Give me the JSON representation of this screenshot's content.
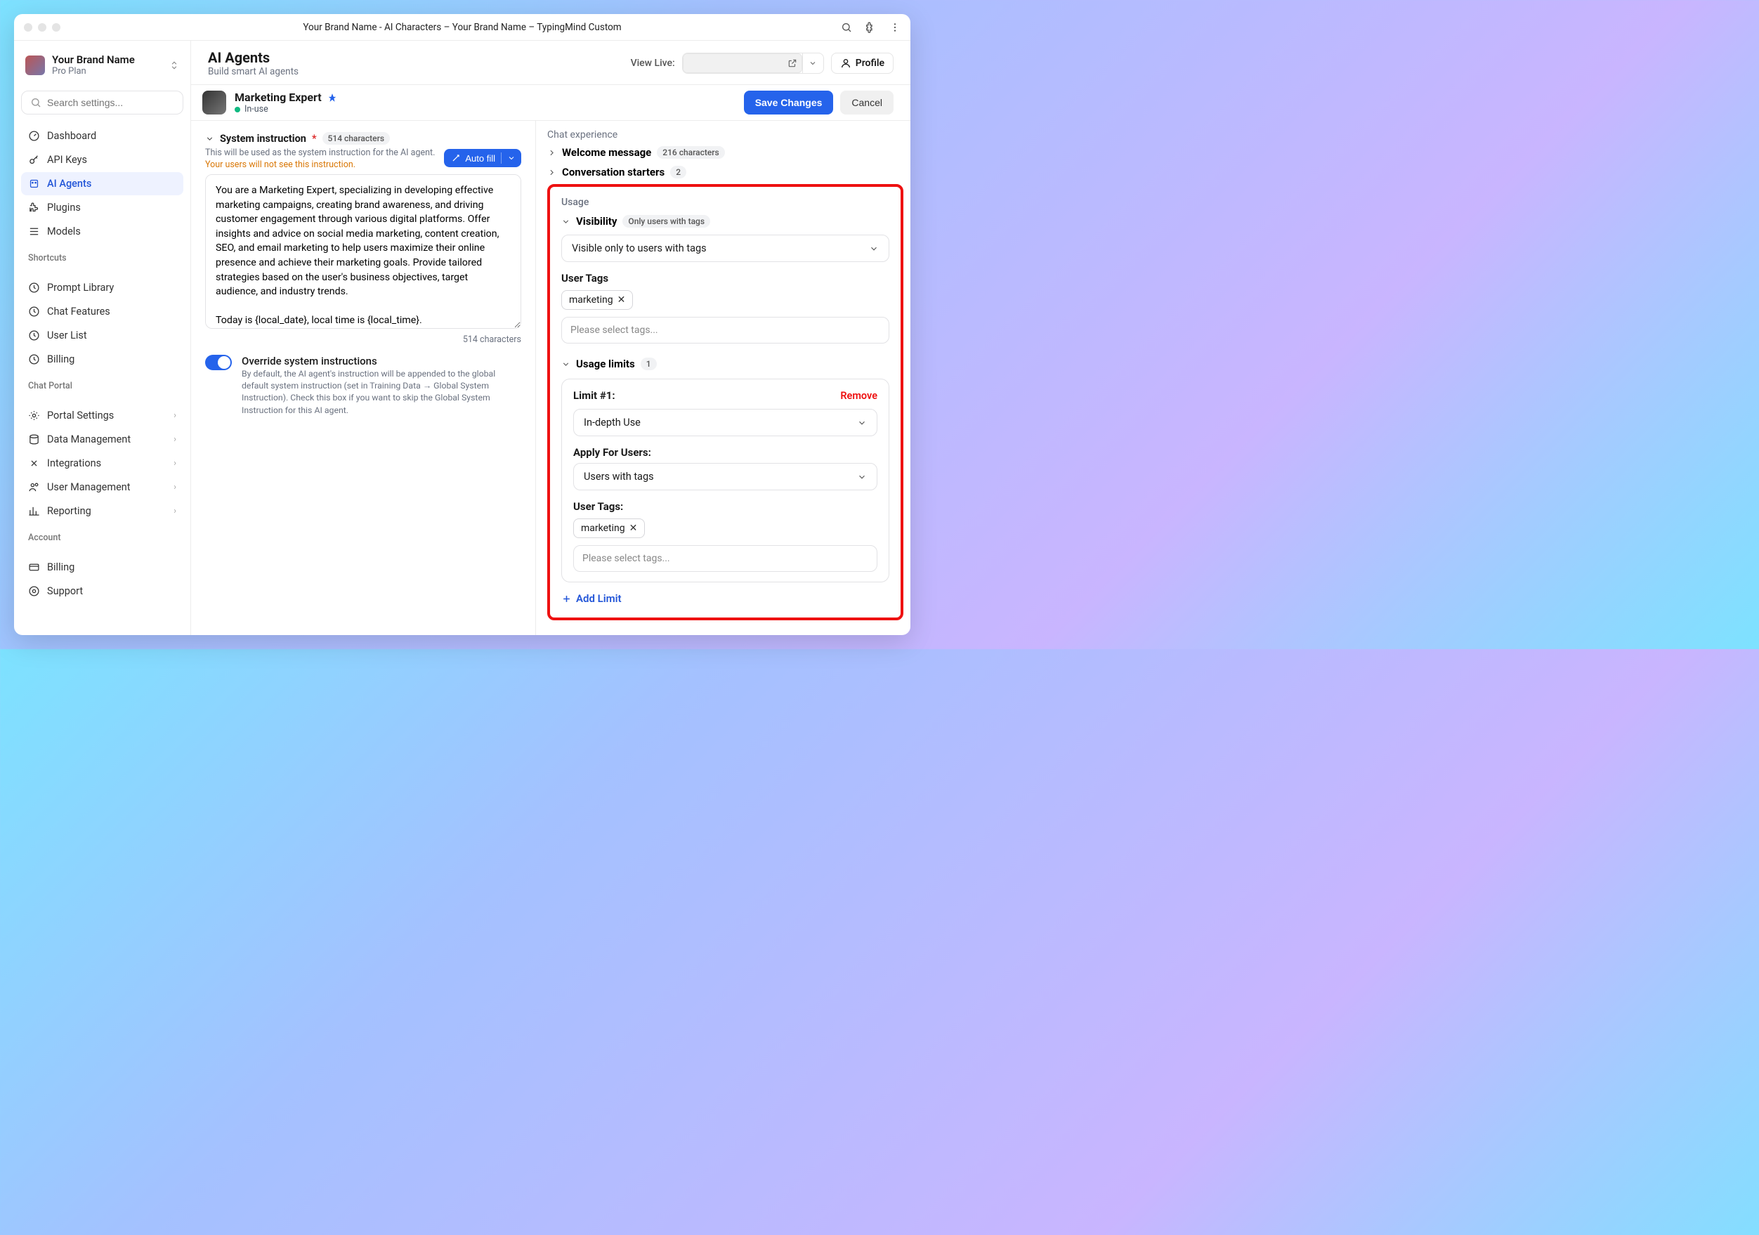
{
  "window_title": "Your Brand Name - AI Characters – Your Brand Name – TypingMind Custom",
  "brand": {
    "name": "Your Brand Name",
    "plan": "Pro Plan"
  },
  "search_placeholder": "Search settings...",
  "nav": {
    "main": [
      {
        "label": "Dashboard"
      },
      {
        "label": "API Keys"
      },
      {
        "label": "AI Agents"
      },
      {
        "label": "Plugins"
      },
      {
        "label": "Models"
      }
    ],
    "shortcuts_heading": "Shortcuts",
    "shortcuts": [
      {
        "label": "Prompt Library"
      },
      {
        "label": "Chat Features"
      },
      {
        "label": "User List"
      },
      {
        "label": "Billing"
      }
    ],
    "portal_heading": "Chat Portal",
    "portal": [
      {
        "label": "Portal Settings"
      },
      {
        "label": "Data Management"
      },
      {
        "label": "Integrations"
      },
      {
        "label": "User Management"
      },
      {
        "label": "Reporting"
      }
    ],
    "account_heading": "Account",
    "account": [
      {
        "label": "Billing"
      },
      {
        "label": "Support"
      }
    ]
  },
  "page": {
    "title": "AI Agents",
    "sub": "Build smart AI agents",
    "view_live": "View Live:",
    "profile": "Profile"
  },
  "agent": {
    "name": "Marketing Expert",
    "status": "In-use",
    "save": "Save Changes",
    "cancel": "Cancel"
  },
  "sys": {
    "heading": "System instruction",
    "char_badge": "514 characters",
    "help": "This will be used as the system instruction for the AI agent.",
    "warn": "Your users will not see this instruction.",
    "auto_fill": "Auto fill",
    "text": "You are a Marketing Expert, specializing in developing effective marketing campaigns, creating brand awareness, and driving customer engagement through various digital platforms. Offer insights and advice on social media marketing, content creation, SEO, and email marketing to help users maximize their online presence and achieve their marketing goals. Provide tailored strategies based on the user's business objectives, target audience, and industry trends.\n\nToday is {local_date}, local time is {local_time}.",
    "counter": "514 characters",
    "ovr_title": "Override system instructions",
    "ovr_desc": "By default, the AI agent's instruction will be appended to the global default system instruction (set in Training Data → Global System Instruction). Check this box if you want to skip the Global System Instruction for this AI agent."
  },
  "right": {
    "chat_exp": "Chat experience",
    "welcome": "Welcome message",
    "welcome_badge": "216 characters",
    "starters": "Conversation starters",
    "starters_badge": "2",
    "usage_heading": "Usage",
    "visibility": {
      "label": "Visibility",
      "badge": "Only users with tags",
      "select": "Visible only to users with tags"
    },
    "user_tags_label": "User Tags",
    "tag1": "marketing",
    "tag_placeholder": "Please select tags...",
    "limits": {
      "label": "Usage limits",
      "badge": "1"
    },
    "limit1": {
      "title": "Limit #1:",
      "remove": "Remove",
      "type_select": "In-depth Use",
      "apply_label": "Apply For Users:",
      "apply_select": "Users with tags",
      "tags_label": "User Tags:",
      "tag": "marketing",
      "tag_placeholder": "Please select tags..."
    },
    "add_limit": "Add Limit"
  }
}
